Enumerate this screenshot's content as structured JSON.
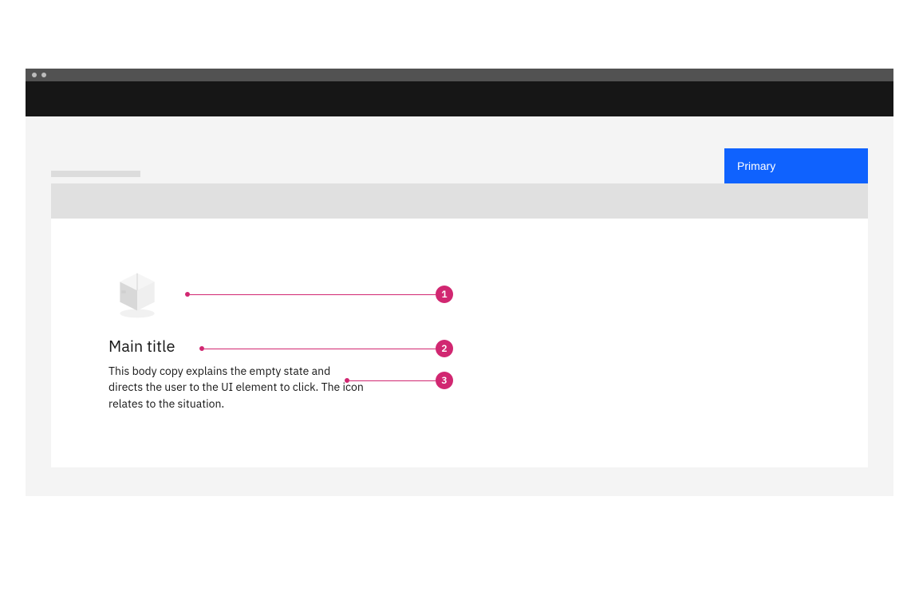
{
  "button": {
    "primary_label": "Primary"
  },
  "empty_state": {
    "title": "Main title",
    "body": "This body copy explains the empty state and directs the user to the UI element to click. The icon relates to the situation."
  },
  "annotations": {
    "a1": "1",
    "a2": "2",
    "a3": "3"
  },
  "colors": {
    "annotation": "#d12771",
    "primary": "#0f62fe"
  }
}
